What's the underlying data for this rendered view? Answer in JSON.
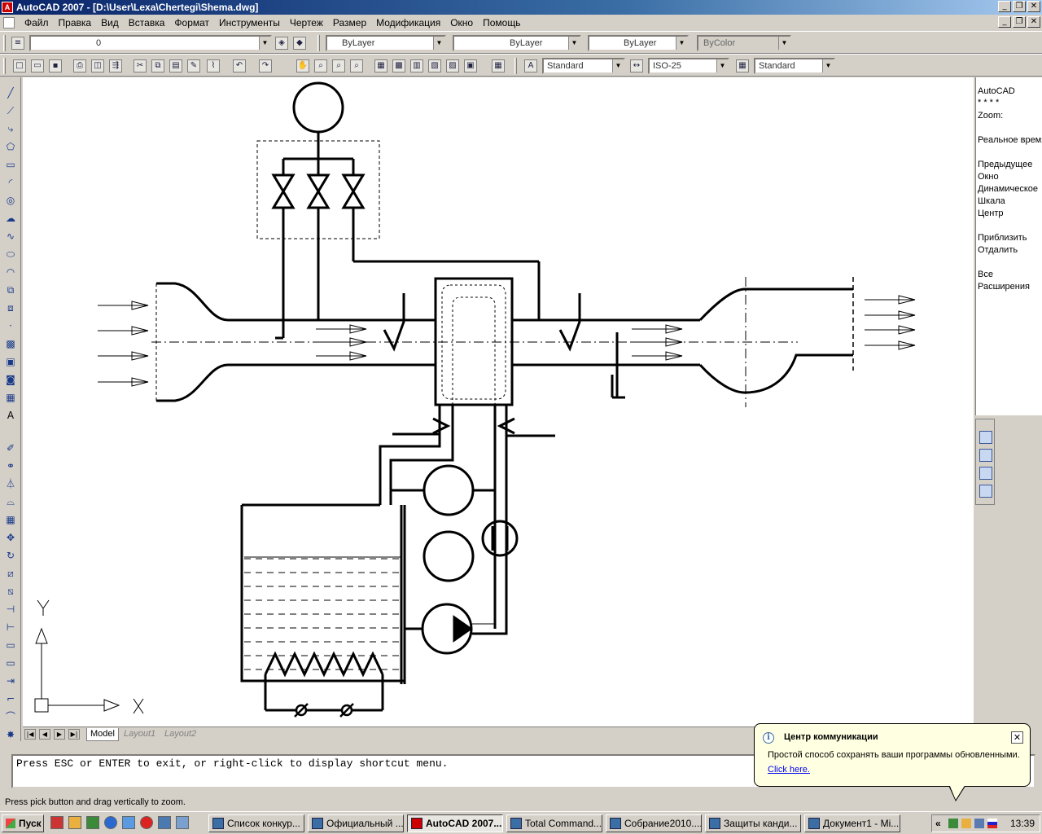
{
  "window": {
    "title": "AutoCAD 2007 - [D:\\User\\Lexa\\Chertegi\\Shema.dwg]",
    "minimize": "_",
    "restore": "❐",
    "close": "✕"
  },
  "menu": {
    "items": [
      "Файл",
      "Правка",
      "Вид",
      "Вставка",
      "Формат",
      "Инструменты",
      "Чертеж",
      "Размер",
      "Модификация",
      "Окно",
      "Помощь"
    ]
  },
  "toolbar_layers": {
    "layer_name": "0",
    "color": "ByLayer",
    "linetype": "ByLayer",
    "lineweight": "ByLayer",
    "plotstyle": "ByColor"
  },
  "toolbar_styles": {
    "text_style": "Standard",
    "dim_style": "ISO-25",
    "table_style": "Standard"
  },
  "right_panel": {
    "lines": [
      "AutoCAD",
      "* * * *",
      "Zoom:",
      "",
      "Реальное время",
      "",
      "Предыдущее",
      "Окно",
      "Динамическое",
      "Шкала",
      "Центр",
      "",
      "Приблизить",
      "Отдалить",
      "",
      "Все",
      "Расширения"
    ]
  },
  "ucs": {
    "y_label": "Y",
    "x_label": "X"
  },
  "tabs": {
    "model": "Model",
    "layout1": "Layout1",
    "layout2": "Layout2"
  },
  "command": {
    "text": "Press ESC or ENTER to exit, or right-click to display shortcut menu."
  },
  "status": {
    "text": "Press pick button and drag vertically to zoom."
  },
  "balloon": {
    "title": "Центр коммуникации",
    "body": "Простой способ сохранять ваши программы обновленными.",
    "link": "Click here.",
    "close": "✕"
  },
  "taskbar": {
    "start": "Пуск",
    "buttons": [
      "Список конкур...",
      "Официальный ...",
      "AutoCAD 2007...",
      "Total Command...",
      "Собрание2010....",
      "Защиты канди...",
      "Документ1 - Mi..."
    ],
    "chevron": "«",
    "clock": "13:39"
  }
}
